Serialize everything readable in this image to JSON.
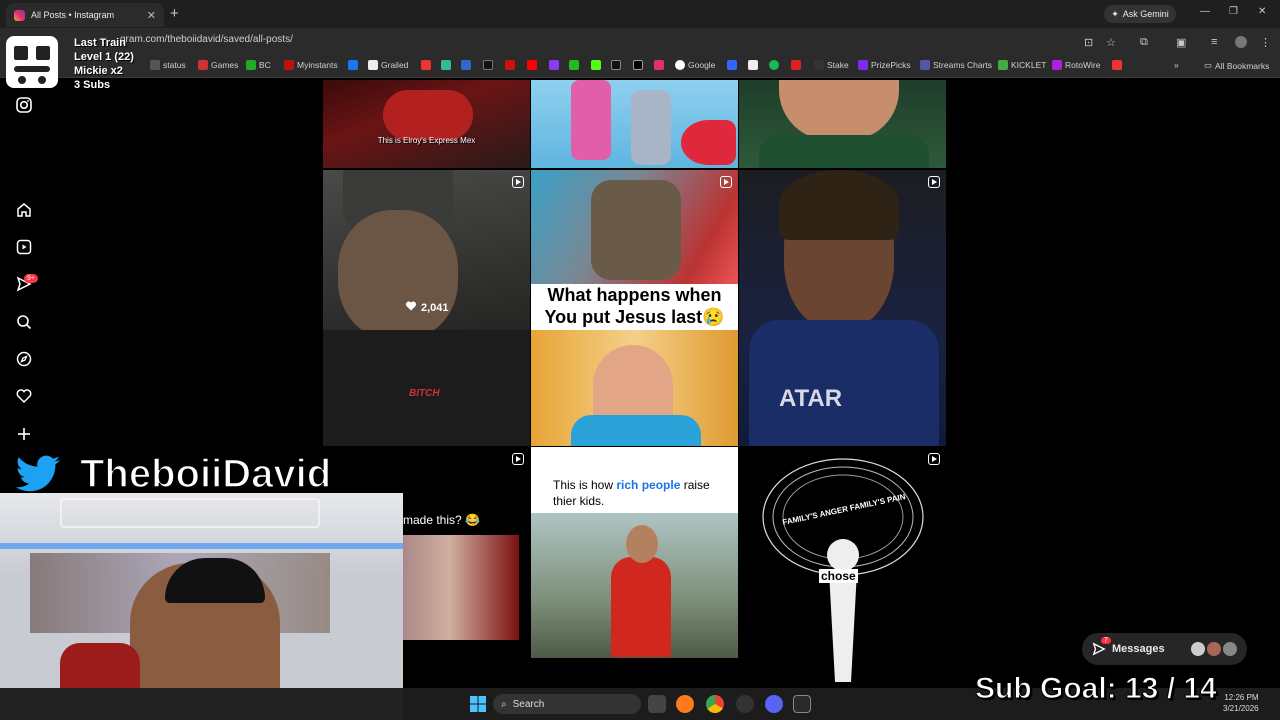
{
  "browser": {
    "tab_title": "All Posts • Instagram",
    "tab_close": "✕",
    "new_tab": "+",
    "ask_gemini": "Ask Gemini",
    "url": "gram.com/theboiidavid/saved/all-posts/",
    "bookmarks": [
      "status",
      "Games",
      "BC",
      "Myinstants",
      "Grailed",
      "Google",
      "Stake",
      "PrizePicks",
      "Streams Charts",
      "KICKLET",
      "RotoWire"
    ],
    "all_bookmarks": "All Bookmarks"
  },
  "overlay": {
    "train_label": "Last Train",
    "level": "Level 1  (22)",
    "multiplier": "Mickie x2",
    "subs": "3 Subs",
    "twitter_handle": "TheboiiDavid",
    "sub_goal": "Sub Goal:  13 / 14"
  },
  "posts": {
    "p1_caption": "This is Elroy's Express Mex",
    "like_count": "2,041",
    "jesus_caption": "What happens when You put Jesus last😢",
    "made_this": "made this? 😂",
    "rich_people_prefix": "This is how ",
    "rich_people_highlight": "rich people",
    "rich_people_suffix": " raise thier kids.",
    "anger_text": "FAMILY'S ANGER FAMILY'S PAIN",
    "chose_text": "chose"
  },
  "messages": {
    "label": "Messages",
    "badge": "7"
  },
  "notif_badge": "9+",
  "taskbar": {
    "search": "Search",
    "time": "12:26 PM",
    "date": "3/21/2026"
  },
  "colors": {
    "accent_blue": "#1a73e8",
    "ig_red": "#ff3040",
    "twitter_blue": "#1da1f2"
  }
}
